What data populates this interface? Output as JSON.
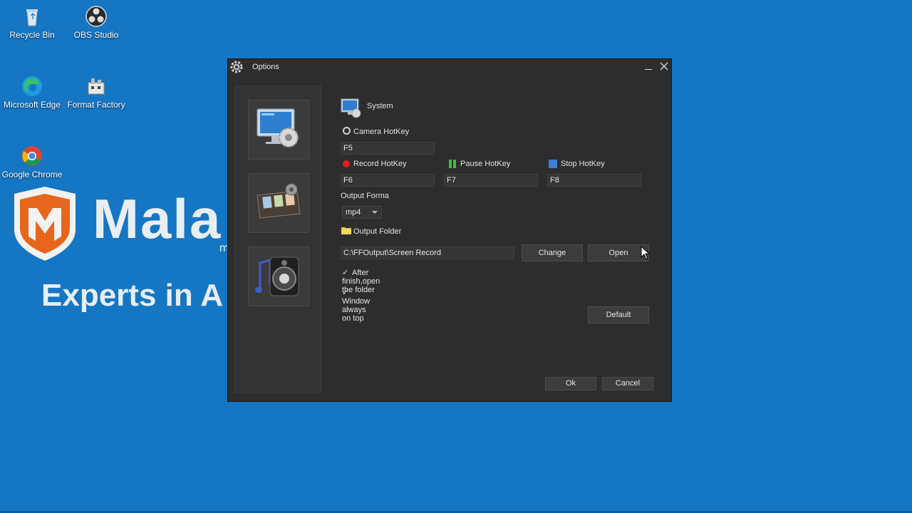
{
  "desktop": {
    "icons": [
      {
        "label": "Recycle Bin"
      },
      {
        "label": "OBS Studio"
      },
      {
        "label": "Microsoft Edge"
      },
      {
        "label": "Format Factory"
      },
      {
        "label": "Google Chrome"
      }
    ],
    "wallpaper": {
      "brand_word": "Mala",
      "brand_small": "m",
      "tagline": "Experts in A"
    }
  },
  "dialog": {
    "title": "Options",
    "nav": [
      {
        "icon": "system-settings-icon"
      },
      {
        "icon": "film-reel-icon"
      },
      {
        "icon": "speaker-music-icon"
      }
    ],
    "section_title": "System",
    "camera_hotkey": {
      "label": "Camera HotKey",
      "value": "F5"
    },
    "record_hotkey": {
      "label": "Record HotKey",
      "value": "F6"
    },
    "pause_hotkey": {
      "label": "Pause HotKey",
      "value": "F7"
    },
    "stop_hotkey": {
      "label": "Stop HotKey",
      "value": "F8"
    },
    "output_format": {
      "label": "Output Forma",
      "value": "mp4"
    },
    "output_folder": {
      "label": "Output Folder",
      "path": "C:\\FFOutput\\Screen Record"
    },
    "buttons": {
      "change": "Change",
      "open": "Open",
      "default": "Default",
      "ok": "Ok",
      "cancel": "Cancel"
    },
    "checkboxes": {
      "after_finish": "After finish,open the folder",
      "always_on_top": "Window always on top"
    },
    "colors": {
      "record": "#e02020",
      "pause": "#3fbf3f",
      "stop": "#3f7fd8"
    }
  }
}
